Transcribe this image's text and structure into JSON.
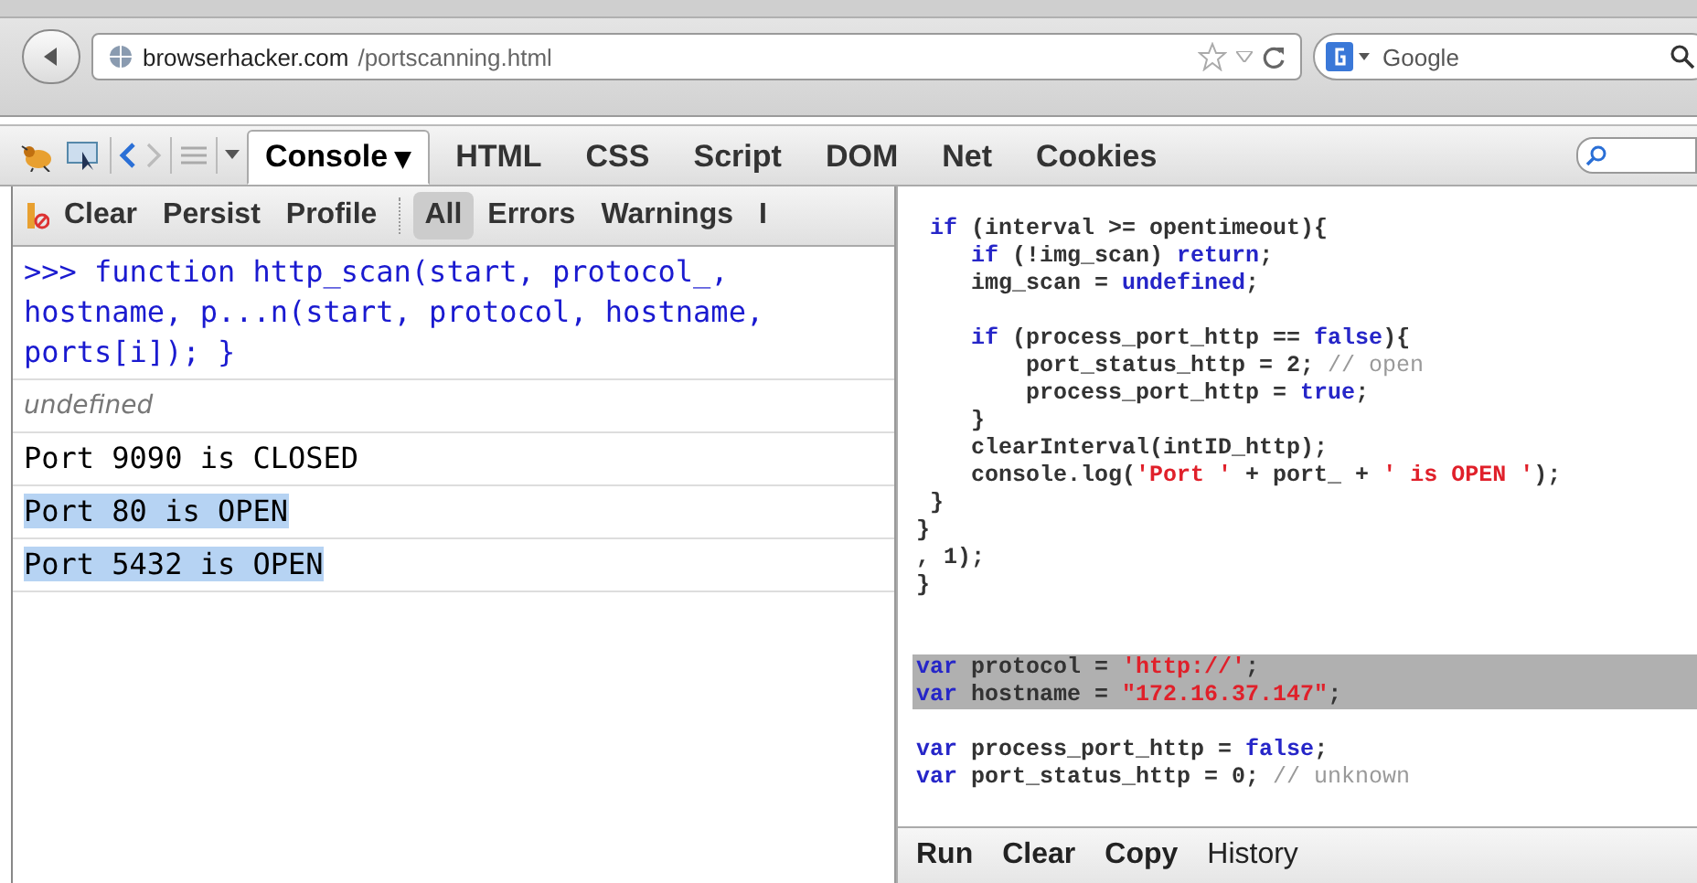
{
  "address_bar": {
    "host": "browserhacker.com",
    "path": "/portscanning.html"
  },
  "search_bar": {
    "placeholder": "Google"
  },
  "firebug_toolbar": {
    "tabs": [
      {
        "label": "Console",
        "selected": true,
        "caret": "▾"
      },
      {
        "label": "HTML",
        "selected": false
      },
      {
        "label": "CSS",
        "selected": false
      },
      {
        "label": "Script",
        "selected": false
      },
      {
        "label": "DOM",
        "selected": false
      },
      {
        "label": "Net",
        "selected": false
      },
      {
        "label": "Cookies",
        "selected": false
      }
    ]
  },
  "console": {
    "actions": [
      "Clear",
      "Persist",
      "Profile"
    ],
    "filters": [
      {
        "label": "All",
        "selected": true
      },
      {
        "label": "Errors",
        "selected": false
      },
      {
        "label": "Warnings",
        "selected": false
      },
      {
        "label": "I",
        "selected": false
      }
    ],
    "rows": [
      {
        "kind": "command",
        "text": ">>> function http_scan(start, protocol_, hostname, p...n(start, protocol, hostname, ports[i]); }"
      },
      {
        "kind": "result",
        "text": "undefined"
      },
      {
        "kind": "log",
        "text": "Port 9090 is CLOSED",
        "selected": false
      },
      {
        "kind": "log",
        "text": "Port 80 is OPEN",
        "selected": true
      },
      {
        "kind": "log",
        "text": "Port 5432 is OPEN",
        "selected": true
      }
    ]
  },
  "editor": {
    "lines": [
      {
        "selected": false,
        "tokens": [
          {
            "kind": "kw",
            "text": " if"
          },
          {
            "kind": "plain",
            "text": " (interval >= opentimeout){"
          }
        ]
      },
      {
        "selected": false,
        "tokens": [
          {
            "kind": "kw",
            "text": "    if"
          },
          {
            "kind": "plain",
            "text": " (!img_scan) "
          },
          {
            "kind": "kw",
            "text": "return"
          },
          {
            "kind": "plain",
            "text": ";"
          }
        ]
      },
      {
        "selected": false,
        "tokens": [
          {
            "kind": "plain",
            "text": "    img_scan = "
          },
          {
            "kind": "kw",
            "text": "undefined"
          },
          {
            "kind": "plain",
            "text": ";"
          }
        ]
      },
      {
        "kind": "blank"
      },
      {
        "selected": false,
        "tokens": [
          {
            "kind": "kw",
            "text": "    if"
          },
          {
            "kind": "plain",
            "text": " (process_port_http == "
          },
          {
            "kind": "kw",
            "text": "false"
          },
          {
            "kind": "plain",
            "text": "){"
          }
        ]
      },
      {
        "selected": false,
        "tokens": [
          {
            "kind": "plain",
            "text": "        port_status_http = 2; "
          },
          {
            "kind": "comment",
            "text": "// open"
          }
        ]
      },
      {
        "selected": false,
        "tokens": [
          {
            "kind": "plain",
            "text": "        process_port_http = "
          },
          {
            "kind": "kw",
            "text": "true"
          },
          {
            "kind": "plain",
            "text": ";"
          }
        ]
      },
      {
        "selected": false,
        "tokens": [
          {
            "kind": "plain",
            "text": "    }"
          }
        ]
      },
      {
        "selected": false,
        "tokens": [
          {
            "kind": "plain",
            "text": "    clearInterval(intID_http);"
          }
        ]
      },
      {
        "selected": false,
        "tokens": [
          {
            "kind": "plain",
            "text": "    console.log("
          },
          {
            "kind": "str",
            "text": "'Port '"
          },
          {
            "kind": "plain",
            "text": " + port_ + "
          },
          {
            "kind": "str",
            "text": "' is OPEN '"
          },
          {
            "kind": "plain",
            "text": ");"
          }
        ]
      },
      {
        "selected": false,
        "tokens": [
          {
            "kind": "plain",
            "text": " }"
          }
        ]
      },
      {
        "selected": false,
        "tokens": [
          {
            "kind": "plain",
            "text": "}"
          }
        ]
      },
      {
        "selected": false,
        "tokens": [
          {
            "kind": "plain",
            "text": ", 1);"
          }
        ]
      },
      {
        "selected": false,
        "tokens": [
          {
            "kind": "plain",
            "text": "}"
          }
        ]
      },
      {
        "kind": "blank"
      },
      {
        "kind": "blank"
      },
      {
        "selected": true,
        "tokens": [
          {
            "kind": "kw",
            "text": "var"
          },
          {
            "kind": "plain",
            "text": " protocol = "
          },
          {
            "kind": "str",
            "text": "'http://'"
          },
          {
            "kind": "plain",
            "text": ";"
          }
        ]
      },
      {
        "selected": true,
        "tokens": [
          {
            "kind": "kw",
            "text": "var"
          },
          {
            "kind": "plain",
            "text": " hostname = "
          },
          {
            "kind": "str",
            "text": "\"172.16.37.147\""
          },
          {
            "kind": "plain",
            "text": ";"
          }
        ]
      },
      {
        "kind": "blank"
      },
      {
        "selected": false,
        "tokens": [
          {
            "kind": "kw",
            "text": "var"
          },
          {
            "kind": "plain",
            "text": " process_port_http = "
          },
          {
            "kind": "kw",
            "text": "false"
          },
          {
            "kind": "plain",
            "text": ";"
          }
        ]
      },
      {
        "selected": false,
        "tokens": [
          {
            "kind": "kw",
            "text": "var"
          },
          {
            "kind": "plain",
            "text": " port_status_http = 0; "
          },
          {
            "kind": "comment",
            "text": "// unknown"
          }
        ]
      }
    ],
    "actions": [
      "Run",
      "Clear",
      "Copy",
      "History"
    ]
  }
}
